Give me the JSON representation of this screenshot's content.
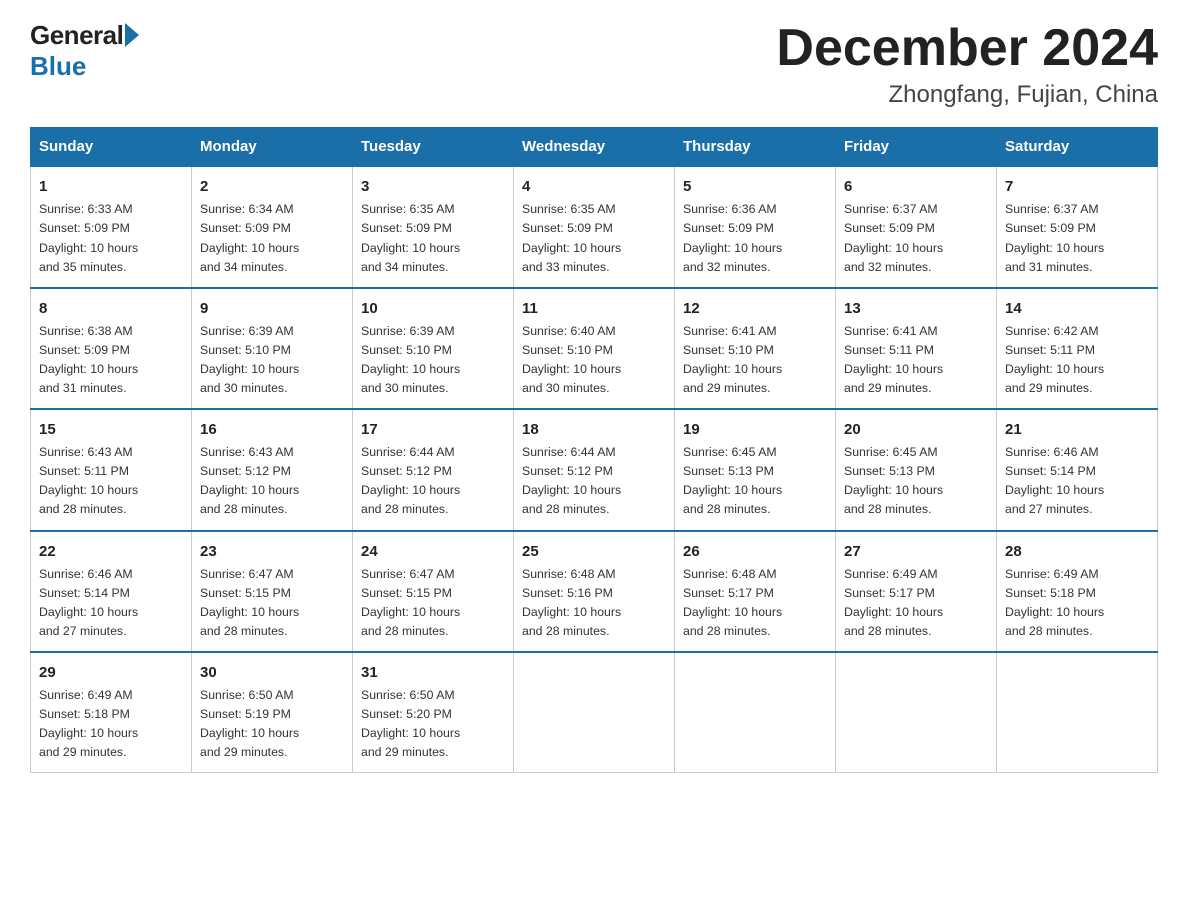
{
  "header": {
    "logo_general": "General",
    "logo_blue": "Blue",
    "month_title": "December 2024",
    "location": "Zhongfang, Fujian, China"
  },
  "weekdays": [
    "Sunday",
    "Monday",
    "Tuesday",
    "Wednesday",
    "Thursday",
    "Friday",
    "Saturday"
  ],
  "weeks": [
    [
      {
        "day": "1",
        "info": "Sunrise: 6:33 AM\nSunset: 5:09 PM\nDaylight: 10 hours\nand 35 minutes."
      },
      {
        "day": "2",
        "info": "Sunrise: 6:34 AM\nSunset: 5:09 PM\nDaylight: 10 hours\nand 34 minutes."
      },
      {
        "day": "3",
        "info": "Sunrise: 6:35 AM\nSunset: 5:09 PM\nDaylight: 10 hours\nand 34 minutes."
      },
      {
        "day": "4",
        "info": "Sunrise: 6:35 AM\nSunset: 5:09 PM\nDaylight: 10 hours\nand 33 minutes."
      },
      {
        "day": "5",
        "info": "Sunrise: 6:36 AM\nSunset: 5:09 PM\nDaylight: 10 hours\nand 32 minutes."
      },
      {
        "day": "6",
        "info": "Sunrise: 6:37 AM\nSunset: 5:09 PM\nDaylight: 10 hours\nand 32 minutes."
      },
      {
        "day": "7",
        "info": "Sunrise: 6:37 AM\nSunset: 5:09 PM\nDaylight: 10 hours\nand 31 minutes."
      }
    ],
    [
      {
        "day": "8",
        "info": "Sunrise: 6:38 AM\nSunset: 5:09 PM\nDaylight: 10 hours\nand 31 minutes."
      },
      {
        "day": "9",
        "info": "Sunrise: 6:39 AM\nSunset: 5:10 PM\nDaylight: 10 hours\nand 30 minutes."
      },
      {
        "day": "10",
        "info": "Sunrise: 6:39 AM\nSunset: 5:10 PM\nDaylight: 10 hours\nand 30 minutes."
      },
      {
        "day": "11",
        "info": "Sunrise: 6:40 AM\nSunset: 5:10 PM\nDaylight: 10 hours\nand 30 minutes."
      },
      {
        "day": "12",
        "info": "Sunrise: 6:41 AM\nSunset: 5:10 PM\nDaylight: 10 hours\nand 29 minutes."
      },
      {
        "day": "13",
        "info": "Sunrise: 6:41 AM\nSunset: 5:11 PM\nDaylight: 10 hours\nand 29 minutes."
      },
      {
        "day": "14",
        "info": "Sunrise: 6:42 AM\nSunset: 5:11 PM\nDaylight: 10 hours\nand 29 minutes."
      }
    ],
    [
      {
        "day": "15",
        "info": "Sunrise: 6:43 AM\nSunset: 5:11 PM\nDaylight: 10 hours\nand 28 minutes."
      },
      {
        "day": "16",
        "info": "Sunrise: 6:43 AM\nSunset: 5:12 PM\nDaylight: 10 hours\nand 28 minutes."
      },
      {
        "day": "17",
        "info": "Sunrise: 6:44 AM\nSunset: 5:12 PM\nDaylight: 10 hours\nand 28 minutes."
      },
      {
        "day": "18",
        "info": "Sunrise: 6:44 AM\nSunset: 5:12 PM\nDaylight: 10 hours\nand 28 minutes."
      },
      {
        "day": "19",
        "info": "Sunrise: 6:45 AM\nSunset: 5:13 PM\nDaylight: 10 hours\nand 28 minutes."
      },
      {
        "day": "20",
        "info": "Sunrise: 6:45 AM\nSunset: 5:13 PM\nDaylight: 10 hours\nand 28 minutes."
      },
      {
        "day": "21",
        "info": "Sunrise: 6:46 AM\nSunset: 5:14 PM\nDaylight: 10 hours\nand 27 minutes."
      }
    ],
    [
      {
        "day": "22",
        "info": "Sunrise: 6:46 AM\nSunset: 5:14 PM\nDaylight: 10 hours\nand 27 minutes."
      },
      {
        "day": "23",
        "info": "Sunrise: 6:47 AM\nSunset: 5:15 PM\nDaylight: 10 hours\nand 28 minutes."
      },
      {
        "day": "24",
        "info": "Sunrise: 6:47 AM\nSunset: 5:15 PM\nDaylight: 10 hours\nand 28 minutes."
      },
      {
        "day": "25",
        "info": "Sunrise: 6:48 AM\nSunset: 5:16 PM\nDaylight: 10 hours\nand 28 minutes."
      },
      {
        "day": "26",
        "info": "Sunrise: 6:48 AM\nSunset: 5:17 PM\nDaylight: 10 hours\nand 28 minutes."
      },
      {
        "day": "27",
        "info": "Sunrise: 6:49 AM\nSunset: 5:17 PM\nDaylight: 10 hours\nand 28 minutes."
      },
      {
        "day": "28",
        "info": "Sunrise: 6:49 AM\nSunset: 5:18 PM\nDaylight: 10 hours\nand 28 minutes."
      }
    ],
    [
      {
        "day": "29",
        "info": "Sunrise: 6:49 AM\nSunset: 5:18 PM\nDaylight: 10 hours\nand 29 minutes."
      },
      {
        "day": "30",
        "info": "Sunrise: 6:50 AM\nSunset: 5:19 PM\nDaylight: 10 hours\nand 29 minutes."
      },
      {
        "day": "31",
        "info": "Sunrise: 6:50 AM\nSunset: 5:20 PM\nDaylight: 10 hours\nand 29 minutes."
      },
      {
        "day": "",
        "info": ""
      },
      {
        "day": "",
        "info": ""
      },
      {
        "day": "",
        "info": ""
      },
      {
        "day": "",
        "info": ""
      }
    ]
  ]
}
